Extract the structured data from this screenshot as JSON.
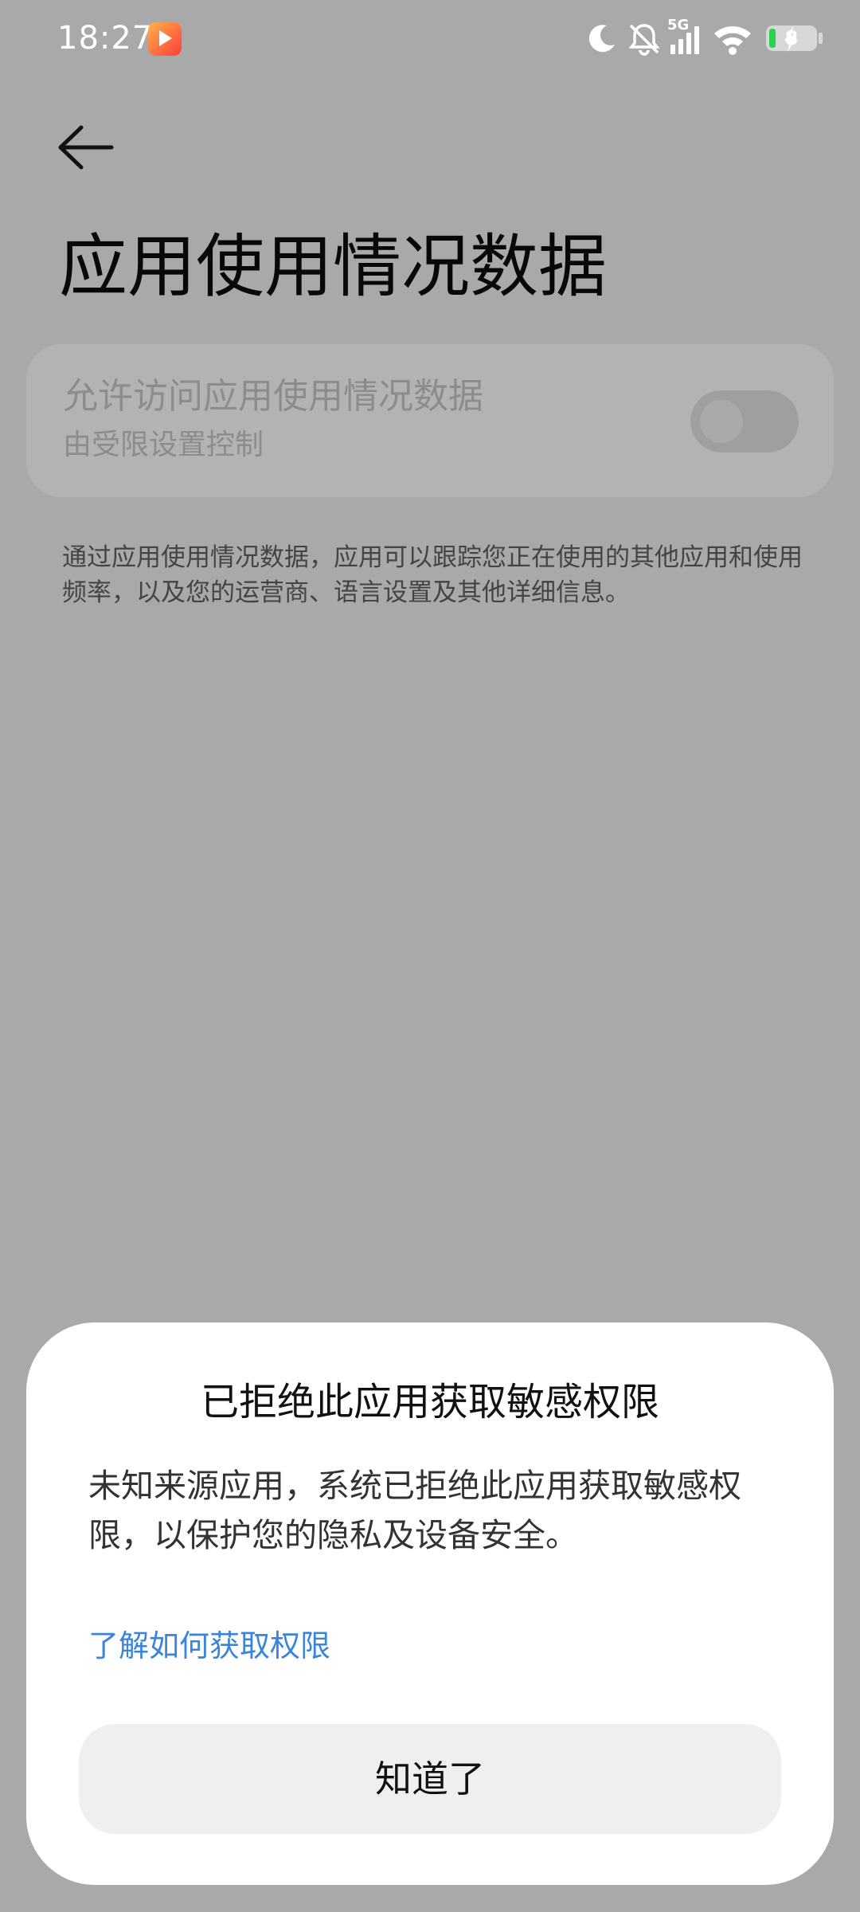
{
  "status_bar": {
    "time": "18:27",
    "network_label": "5G",
    "battery_level": "8",
    "battery_color": "#2bd24e",
    "icons": [
      "app-notification-icon",
      "moon-icon",
      "mute-icon",
      "signal-icon",
      "wifi-icon",
      "battery-icon",
      "charging-icon"
    ]
  },
  "page": {
    "title": "应用使用情况数据",
    "setting": {
      "label": "允许访问应用使用情况数据",
      "sublabel": "由受限设置控制",
      "toggle_on": false
    },
    "description": "通过应用使用情况数据，应用可以跟踪您正在使用的其他应用和使用频率，以及您的运营商、语言设置及其他详细信息。"
  },
  "dialog": {
    "title": "已拒绝此应用获取敏感权限",
    "body": "未知来源应用，系统已拒绝此应用获取敏感权限，以保护您的隐私及设备安全。",
    "link": "了解如何获取权限",
    "link_color": "#3a84e0",
    "confirm_button": "知道了"
  }
}
